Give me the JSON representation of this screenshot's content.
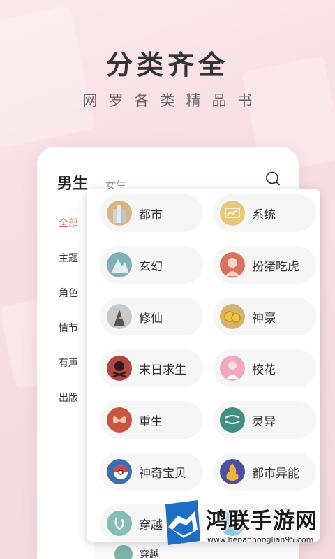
{
  "hero": {
    "title": "分类齐全",
    "subtitle": "网罗各类精品书"
  },
  "tabs": {
    "male": "男生",
    "female": "女生"
  },
  "sidebar": {
    "items": [
      {
        "label": "全部",
        "active": true
      },
      {
        "label": "主题",
        "active": false
      },
      {
        "label": "角色",
        "active": false
      },
      {
        "label": "情节",
        "active": false
      },
      {
        "label": "有声",
        "active": false
      },
      {
        "label": "出版",
        "active": false
      }
    ]
  },
  "categories": [
    {
      "label": "都市",
      "icon": "city-buildings-icon"
    },
    {
      "label": "系统",
      "icon": "system-chart-icon"
    },
    {
      "label": "玄幻",
      "icon": "fantasy-mountain-icon"
    },
    {
      "label": "扮猪吃虎",
      "icon": "girl-portrait-icon"
    },
    {
      "label": "修仙",
      "icon": "immortal-cultivator-icon"
    },
    {
      "label": "神豪",
      "icon": "gold-coins-icon"
    },
    {
      "label": "末日求生",
      "icon": "skull-icon"
    },
    {
      "label": "校花",
      "icon": "schoolgirl-icon"
    },
    {
      "label": "重生",
      "icon": "butterfly-icon"
    },
    {
      "label": "灵异",
      "icon": "spirit-swirl-icon"
    },
    {
      "label": "神奇宝贝",
      "icon": "pokeball-icon"
    },
    {
      "label": "都市异能",
      "icon": "flame-power-icon"
    },
    {
      "label": "穿越",
      "icon": "time-travel-icon"
    }
  ],
  "peek_item": {
    "label": "穿越"
  },
  "watermark": {
    "brand": "鸿联手游网",
    "url": "www.henanhonglian95.com"
  },
  "colors": {
    "accent": "#e0644f",
    "background": "#f8dfe3"
  }
}
